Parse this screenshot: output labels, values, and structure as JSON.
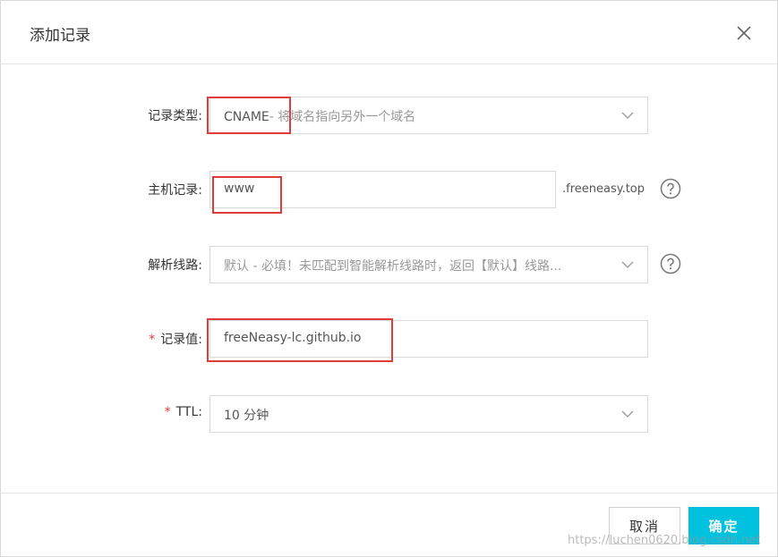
{
  "dialog": {
    "title": "添加记录",
    "close_icon": "close-icon"
  },
  "form": {
    "record_type": {
      "label": "记录类型:",
      "value_prefix": "CNAME",
      "value_rest": "- 将域名指向另外一个域名"
    },
    "host_record": {
      "label": "主机记录:",
      "value": "www",
      "suffix": ".freeneasy.top"
    },
    "resolve_line": {
      "label": "解析线路:",
      "value": "默认 - 必填！未匹配到智能解析线路时，返回【默认】线路..."
    },
    "record_value": {
      "required": "*",
      "label": "记录值:",
      "value": "freeNeasy-lc.github.io"
    },
    "ttl": {
      "required": "*",
      "label": "TTL:",
      "value": "10 分钟"
    }
  },
  "footer": {
    "cancel_label": "取消",
    "ok_label": "确定"
  },
  "watermark": "https://luchen0620.blog.csdn.net",
  "colors": {
    "primary": "#00c1de",
    "required": "#e4393c",
    "annotation": "#e03c3c"
  }
}
